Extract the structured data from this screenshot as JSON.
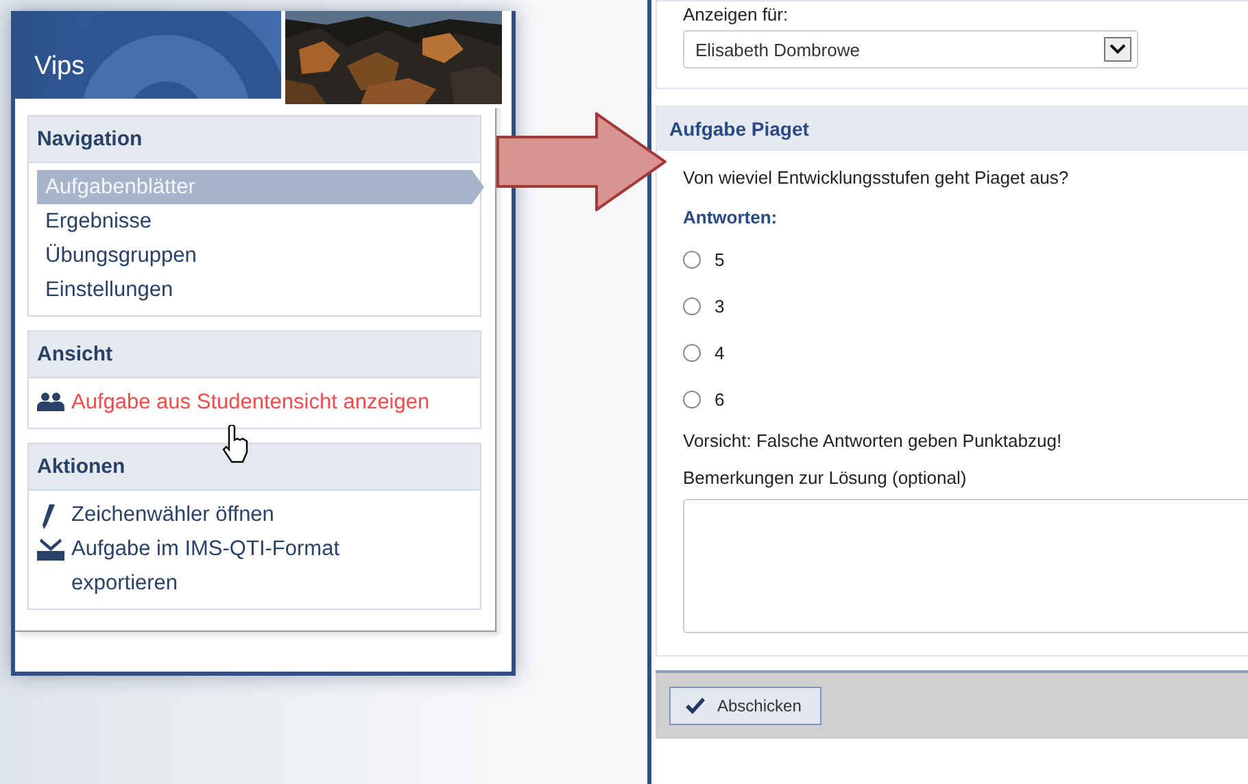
{
  "sidebar": {
    "title": "Vips",
    "sections": [
      {
        "title": "Navigation",
        "kind": "nav",
        "items": [
          {
            "label": "Aufgabenblätter",
            "selected": true
          },
          {
            "label": "Ergebnisse",
            "selected": false
          },
          {
            "label": "Übungsgruppen",
            "selected": false
          },
          {
            "label": "Einstellungen",
            "selected": false
          }
        ]
      },
      {
        "title": "Ansicht",
        "kind": "links",
        "items": [
          {
            "label": "Aufgabe aus Studentensicht anzeigen",
            "hovered": true
          }
        ]
      },
      {
        "title": "Aktionen",
        "kind": "links",
        "items": [
          {
            "label": "Zeichenwähler öffnen",
            "hovered": false
          },
          {
            "label": "Aufgabe im IMS-QTI-Format exportieren",
            "hovered": false
          }
        ]
      }
    ]
  },
  "filter": {
    "label": "Anzeigen für:",
    "value": "Elisabeth Dombrowe"
  },
  "task": {
    "title": "Aufgabe Piaget",
    "question": "Von wieviel Entwicklungsstufen geht Piaget aus?",
    "answers_label": "Antworten:",
    "options": [
      {
        "label": "5",
        "selected": false
      },
      {
        "label": "3",
        "selected": false
      },
      {
        "label": "4",
        "selected": false
      },
      {
        "label": "6",
        "selected": false
      }
    ],
    "warning": "Vorsicht: Falsche Antworten geben Punktabzug!",
    "remarks_label": "Bemerkungen zur Lösung (optional)"
  },
  "submit_button": "Abschicken"
}
